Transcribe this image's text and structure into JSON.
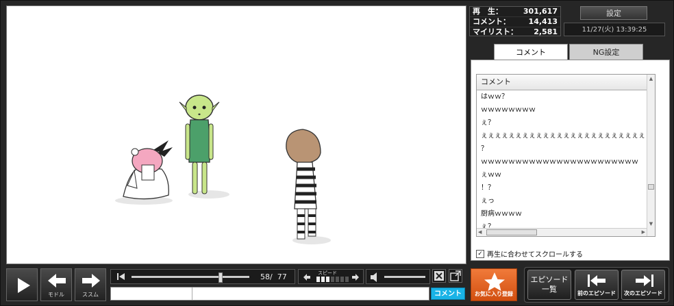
{
  "stats": {
    "plays_label": "再　生：",
    "plays": "301,617",
    "comments_label": "コメント：",
    "comments": "14,413",
    "mylist_label": "マイリスト：",
    "mylist": "2,581"
  },
  "settings_label": "設定",
  "datetime": "11/27(火) 13:39:25",
  "tabs": {
    "comment": "コメント",
    "ng": "NG設定"
  },
  "comment_list": {
    "header": "コメント",
    "items": [
      "はｗｗ？",
      "ｗｗｗｗｗｗｗｗ",
      "ぇ？",
      "ぇぇぇぇぇぇぇぇぇぇぇぇぇぇぇぇぇぇぇぇぇぇぇぇぇぇぇぇ",
      "？",
      "ｗｗｗｗｗｗｗｗｗｗｗｗｗｗｗｗｗｗｗｗｗｗｗ",
      "ぇｗｗ",
      "！？",
      "ぇっ",
      "厨病ｗｗｗｗ",
      "ぇ？"
    ],
    "autoscroll_label": "再生に合わせてスクロールする"
  },
  "controls": {
    "back_label": "モドル",
    "forward_label": "ススム",
    "frame_current": "58",
    "frame_total": "77",
    "frame_sep": "/",
    "seek_progress": 0.75,
    "speed_label": "スピード",
    "comment_submit": "コメント"
  },
  "favorite_label": "お気に入り登録",
  "episodes": {
    "list_label_1": "エピソード",
    "list_label_2": "一覧",
    "prev_label": "前のエピソード",
    "next_label": "次のエピソード"
  },
  "colors": {
    "accent_orange": "#e8642a",
    "submit_blue": "#19b3e6"
  }
}
